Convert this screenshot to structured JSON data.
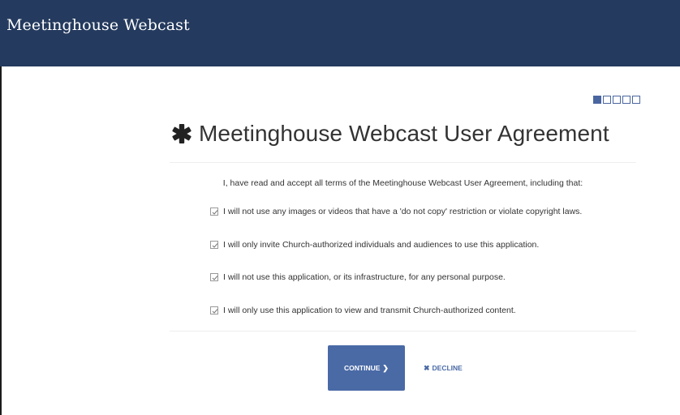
{
  "header": {
    "title": "Meetinghouse Webcast",
    "background": "#243a5e"
  },
  "progress": {
    "current_step": 1,
    "total_steps": 5
  },
  "agreement": {
    "title": "Meetinghouse Webcast User Agreement",
    "title_icon": "asterisk-icon",
    "intro": "I, have read and accept all terms of the Meetinghouse Webcast User Agreement, including that:",
    "terms": [
      {
        "text": "I will not use any images or videos that have a 'do not copy' restriction or violate copyright laws.",
        "checked": true
      },
      {
        "text": "I will only invite Church-authorized individuals and audiences to use this application.",
        "checked": true
      },
      {
        "text": "I will not use this application, or its infrastructure, for any personal purpose.",
        "checked": true
      },
      {
        "text": "I will only use this application to view and transmit Church-authorized content.",
        "checked": true
      }
    ]
  },
  "actions": {
    "continue_label": "CONTINUE",
    "continue_icon": "chevron-right-icon",
    "decline_label": "DECLINE",
    "decline_icon": "close-icon",
    "accent": "#4a6aa6"
  }
}
